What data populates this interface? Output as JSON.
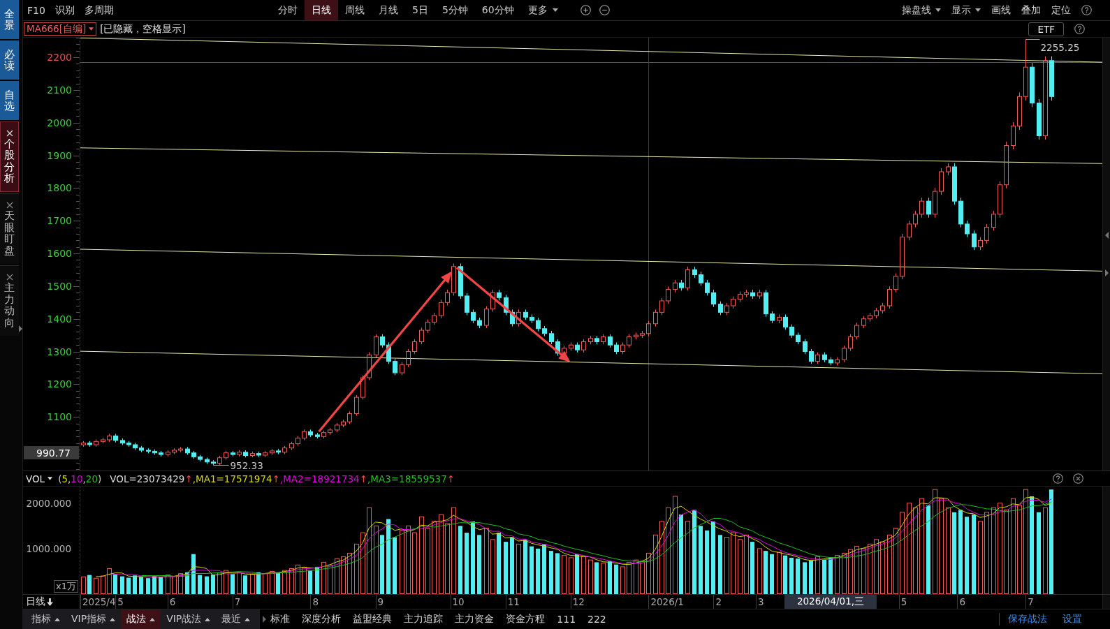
{
  "sidebar": {
    "items": [
      {
        "label": "全景",
        "kind": "fixed",
        "selected": false
      },
      {
        "label": "必读",
        "kind": "fixed",
        "selected": false
      },
      {
        "label": "自选",
        "kind": "fixed",
        "selected": false
      },
      {
        "label": "个股分析",
        "kind": "closable",
        "selected": true
      },
      {
        "label": "天眼盯盘",
        "kind": "closable",
        "selected": false
      },
      {
        "label": "主力动向",
        "kind": "closable",
        "selected": false
      }
    ]
  },
  "toolbar": {
    "tools": [
      "F10",
      "识别",
      "多周期"
    ],
    "periods": [
      {
        "label": "分时",
        "selected": false,
        "dropdown": false
      },
      {
        "label": "日线",
        "selected": true,
        "dropdown": false
      },
      {
        "label": "周线",
        "selected": false,
        "dropdown": false
      },
      {
        "label": "月线",
        "selected": false,
        "dropdown": false
      },
      {
        "label": "5日",
        "selected": false,
        "dropdown": false
      },
      {
        "label": "5分钟",
        "selected": false,
        "dropdown": false
      },
      {
        "label": "60分钟",
        "selected": false,
        "dropdown": false
      },
      {
        "label": "更多",
        "selected": false,
        "dropdown": true
      }
    ],
    "options": [
      {
        "label": "操盘线",
        "dropdown": true
      },
      {
        "label": "显示",
        "dropdown": true
      },
      {
        "label": "画线",
        "dropdown": false
      },
      {
        "label": "叠加",
        "dropdown": false
      },
      {
        "label": "定位",
        "dropdown": false
      }
    ]
  },
  "indicator_bar": {
    "formula": "MA666[自编]",
    "status": "[已隐藏，空格显示]",
    "badge": "ETF"
  },
  "price_chart": {
    "axis_labels": [
      {
        "text": "2200",
        "color": "#e85050"
      },
      {
        "text": "2100",
        "color": "#3fcf3f"
      },
      {
        "text": "2000",
        "color": "#3fcf3f"
      },
      {
        "text": "1900",
        "color": "#3fcf3f"
      },
      {
        "text": "1800",
        "color": "#3fcf3f"
      },
      {
        "text": "1700",
        "color": "#3fcf3f"
      },
      {
        "text": "1600",
        "color": "#3fcf3f"
      },
      {
        "text": "1500",
        "color": "#3fcf3f"
      },
      {
        "text": "1400",
        "color": "#3fcf3f"
      },
      {
        "text": "1300",
        "color": "#3fcf3f"
      },
      {
        "text": "1200",
        "color": "#3fcf3f"
      },
      {
        "text": "1100",
        "color": "#3fcf3f"
      }
    ],
    "cursor_price": "990.77",
    "high_label": "2255.25",
    "low_label": "952.33"
  },
  "volume_panel": {
    "indicator": "VOL",
    "params": [
      {
        "text": "("
      },
      {
        "text": "5",
        "color": "#d8d800"
      },
      {
        "text": ","
      },
      {
        "text": "10",
        "color": "#e000e0"
      },
      {
        "text": ","
      },
      {
        "text": "20",
        "color": "#22c022"
      },
      {
        "text": ")"
      }
    ],
    "readouts": [
      {
        "label": "VOL=23073429",
        "arrow": "↑",
        "color": "#dcdcdc"
      },
      {
        "label": ",MA1=17571974",
        "arrow": "↑",
        "color": "#d8d800"
      },
      {
        "label": ",MA2=18921734",
        "arrow": "↑",
        "color": "#e000e0"
      },
      {
        "label": ",MA3=18559537",
        "arrow": "↑",
        "color": "#22c022"
      }
    ],
    "axis_labels": [
      "2000.000",
      "1000.000"
    ],
    "unit": "x1万"
  },
  "x_axis": {
    "period": "日线",
    "dates": [
      "2025/4",
      "5",
      "6",
      "7",
      "8",
      "9",
      "10",
      "11",
      "12",
      "2026/1",
      "2",
      "3",
      "5",
      "6",
      "7"
    ],
    "cursor_date": "2026/04/01,三"
  },
  "bottom_bar": {
    "tabs": [
      {
        "label": "指标",
        "selected": false
      },
      {
        "label": "VIP指标",
        "selected": false
      },
      {
        "label": "战法",
        "selected": true
      },
      {
        "label": "VIP战法",
        "selected": false
      },
      {
        "label": "最近",
        "selected": false
      }
    ],
    "strategies": [
      "标准",
      "深度分析",
      "益盟经典",
      "主力追踪",
      "主力资金",
      "资金方程",
      "111",
      "222"
    ],
    "actions": [
      "保存战法",
      "设置"
    ]
  }
}
